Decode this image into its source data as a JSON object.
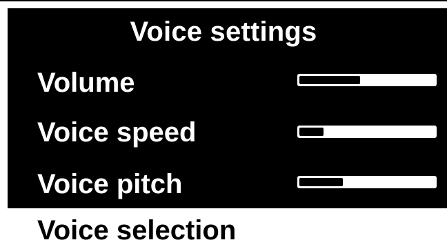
{
  "title": "Voice settings",
  "settings": [
    {
      "label": "Volume",
      "level": 0.45
    },
    {
      "label": "Voice speed",
      "level": 0.18
    },
    {
      "label": "Voice pitch",
      "level": 0.32
    }
  ],
  "bottom_item": {
    "label": "Voice selection"
  },
  "colors": {
    "panel_background": "#000000",
    "text_on_panel": "#ffffff",
    "slider_track": "#ffffff",
    "slider_fill": "#000000",
    "page_background": "#ffffff"
  }
}
